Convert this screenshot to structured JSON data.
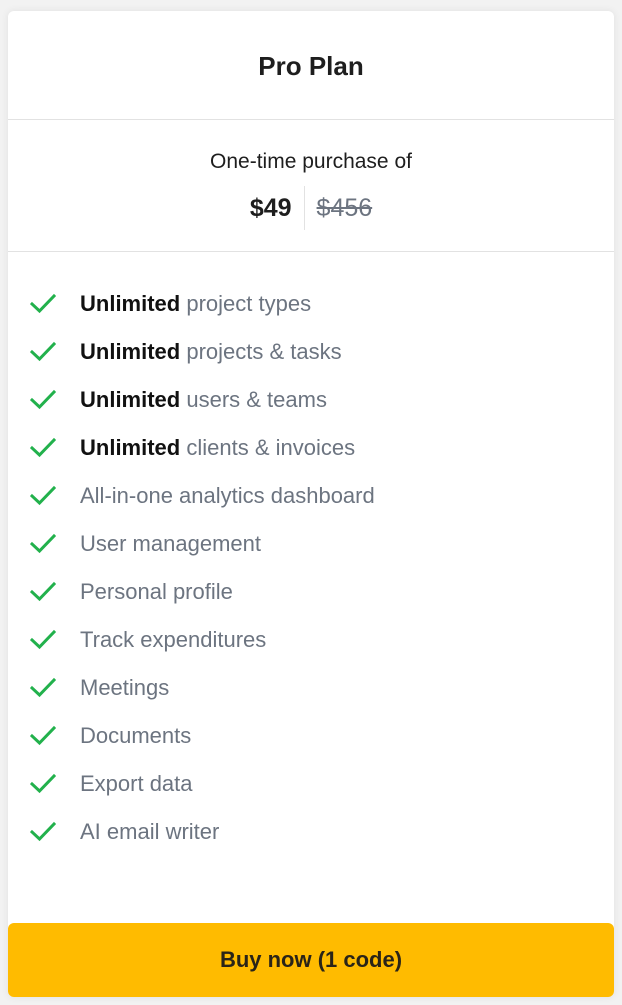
{
  "plan": {
    "title": "Pro Plan",
    "purchase_label": "One-time purchase of",
    "price_current": "$49",
    "price_original": "$456"
  },
  "colors": {
    "check": "#22b14c",
    "button_bg": "#ffbb00"
  },
  "features": [
    {
      "icon": "check-icon",
      "bold": "Unlimited",
      "text": " project types"
    },
    {
      "icon": "check-icon",
      "bold": "Unlimited",
      "text": " projects & tasks"
    },
    {
      "icon": "check-icon",
      "bold": "Unlimited",
      "text": " users & teams"
    },
    {
      "icon": "check-icon",
      "bold": "Unlimited",
      "text": " clients & invoices"
    },
    {
      "icon": "check-icon",
      "bold": "",
      "text": "All-in-one analytics dashboard"
    },
    {
      "icon": "check-icon",
      "bold": "",
      "text": "User management"
    },
    {
      "icon": "check-icon",
      "bold": "",
      "text": "Personal profile"
    },
    {
      "icon": "check-icon",
      "bold": "",
      "text": "Track expenditures"
    },
    {
      "icon": "check-icon",
      "bold": "",
      "text": "Meetings"
    },
    {
      "icon": "check-icon",
      "bold": "",
      "text": "Documents"
    },
    {
      "icon": "check-icon",
      "bold": "",
      "text": "Export data"
    },
    {
      "icon": "check-icon",
      "bold": "",
      "text": "AI email writer"
    }
  ],
  "cta": {
    "label": "Buy now (1 code)"
  }
}
